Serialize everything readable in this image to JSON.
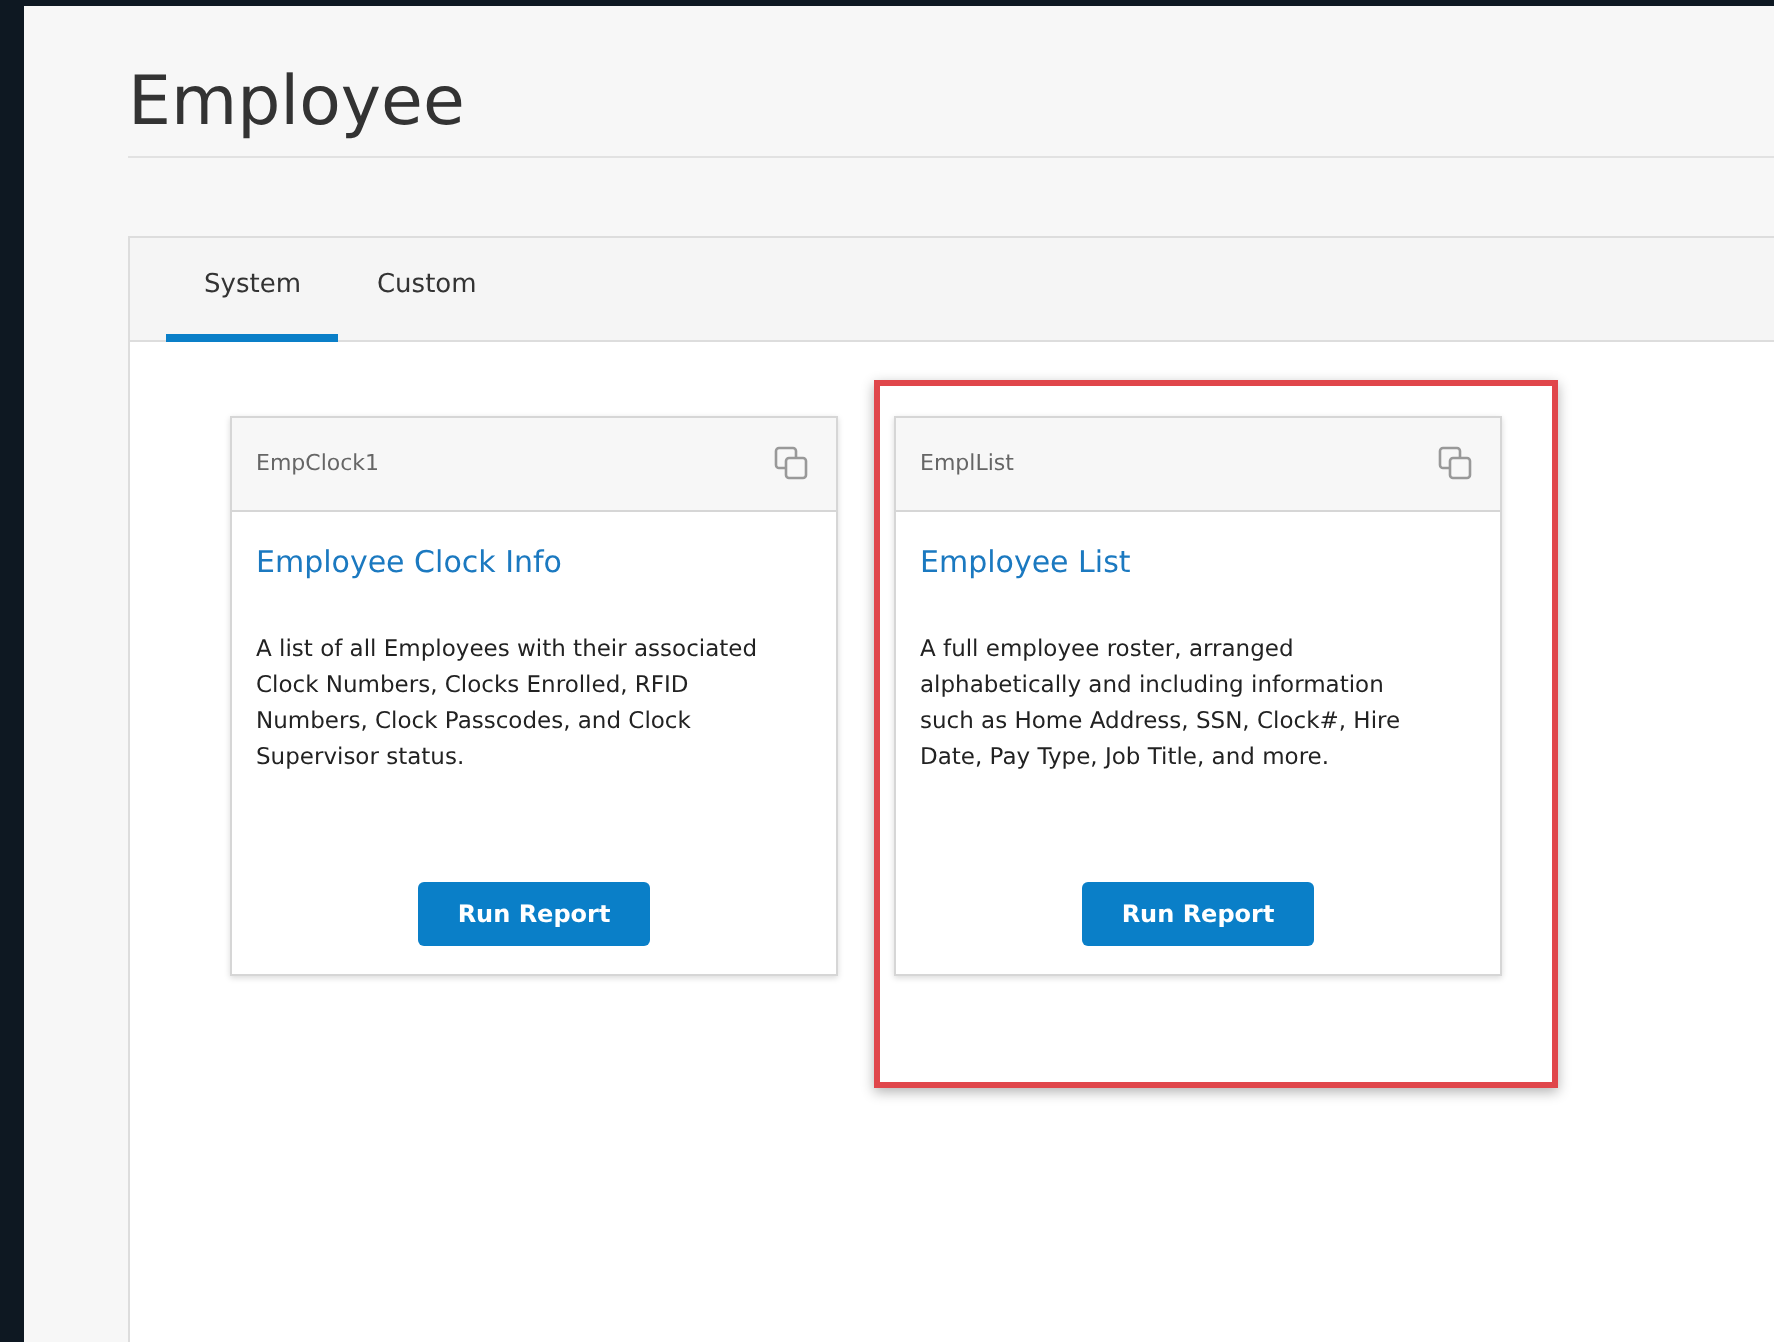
{
  "page_title": "Employee",
  "tabs": [
    {
      "label": "System",
      "selected": true
    },
    {
      "label": "Custom",
      "selected": false
    }
  ],
  "cards": [
    {
      "code": "EmpClock1",
      "title": "Employee Clock Info",
      "description": "A list of all Employees with their associated Clock Numbers, Clocks Enrolled, RFID Numbers, Clock Passcodes, and Clock Supervisor status.",
      "button": "Run Report",
      "highlighted": false
    },
    {
      "code": "EmplList",
      "title": "Employee List",
      "description": "A full employee roster, arranged alphabetically and including information such as Home Address, SSN, Clock#, Hire Date, Pay Type, Job Title, and more.",
      "button": "Run Report",
      "highlighted": true
    }
  ]
}
